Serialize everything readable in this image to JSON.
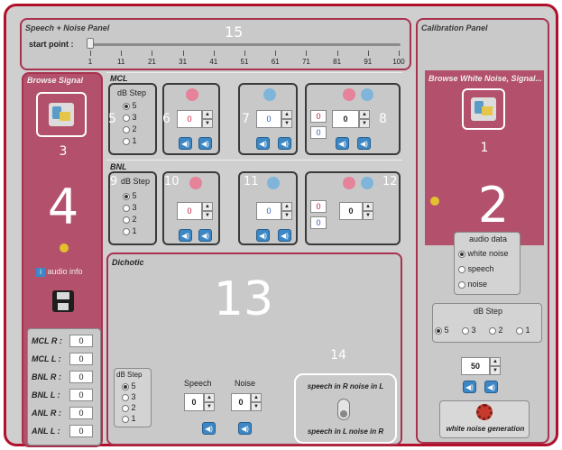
{
  "speech_noise_panel": {
    "title": "Speech + Noise Panel",
    "start_point_label": "start point :",
    "ticks": [
      "1",
      "11",
      "21",
      "31",
      "41",
      "51",
      "61",
      "71",
      "81",
      "91",
      "100"
    ],
    "marker": "15"
  },
  "calibration_panel": {
    "title": "Calibration Panel",
    "browse_title": "Browse White Noise, Signal...",
    "marker_browse": "1",
    "marker_main": "2",
    "audio_data_title": "audio data",
    "audio_options": [
      {
        "label": "white noise",
        "selected": true
      },
      {
        "label": "speech",
        "selected": false
      },
      {
        "label": "noise",
        "selected": false
      }
    ],
    "db_step_title": "dB Step",
    "db_steps": [
      {
        "label": "5",
        "selected": true
      },
      {
        "label": "3",
        "selected": false
      },
      {
        "label": "2",
        "selected": false
      },
      {
        "label": "1",
        "selected": false
      }
    ],
    "level_value": "50",
    "generate_label": "white noise generation"
  },
  "browse_signal": {
    "title": "Browse Signal",
    "marker_button": "3",
    "marker_main": "4",
    "audio_info_label": "audio info",
    "fields": [
      {
        "label": "MCL R :",
        "value": "0"
      },
      {
        "label": "MCL L :",
        "value": "0"
      },
      {
        "label": "BNL R :",
        "value": "0"
      },
      {
        "label": "BNL L :",
        "value": "0"
      },
      {
        "label": "ANL R :",
        "value": "0"
      },
      {
        "label": "ANL L :",
        "value": "0"
      }
    ]
  },
  "mcl": {
    "title": "MCL",
    "db_step_title": "dB Step",
    "db_steps": [
      "5",
      "3",
      "2",
      "1"
    ],
    "markers": [
      "5",
      "6",
      "7",
      "8"
    ],
    "values": {
      "left": "0",
      "right": "0",
      "both_r": "0",
      "both_l": "0",
      "both_main": "0"
    }
  },
  "bnl": {
    "title": "BNL",
    "db_step_title": "dB Step",
    "db_steps": [
      "5",
      "3",
      "2",
      "1"
    ],
    "markers": [
      "9",
      "10",
      "11",
      "12"
    ],
    "values": {
      "left": "0",
      "right": "0",
      "both_r": "0",
      "both_l": "0",
      "both_main": "0"
    }
  },
  "dichotic": {
    "title": "Dichotic",
    "marker_main": "13",
    "marker_toggle": "14",
    "db_step_title": "dB Step",
    "db_steps": [
      "5",
      "3",
      "2",
      "1"
    ],
    "speech_label": "Speech",
    "noise_label": "Noise",
    "speech_value": "0",
    "noise_value": "0",
    "toggle_top": "speech in R noise in L",
    "toggle_bottom": "speech in L noise in R"
  },
  "colors": {
    "accent": "#b2102a",
    "crimson": "#b3506b",
    "speaker": "#3d87c4"
  }
}
